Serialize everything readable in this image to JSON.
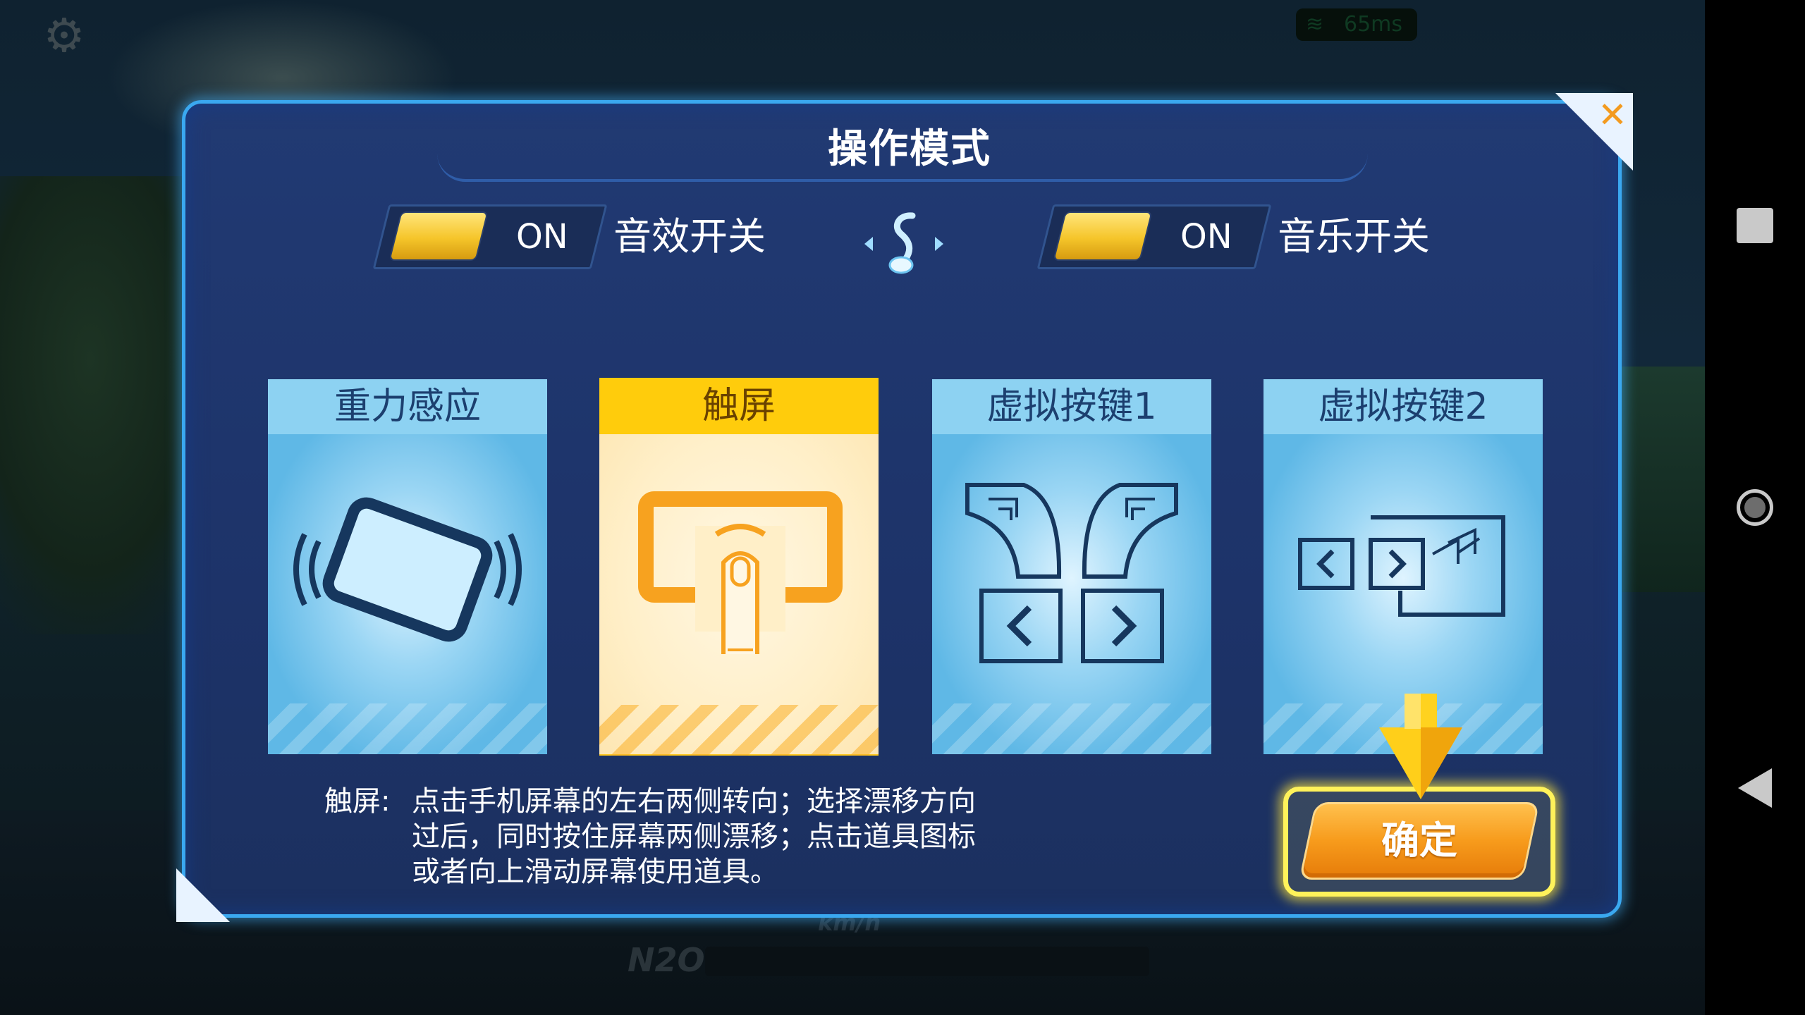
{
  "hud": {
    "ping": "65ms",
    "speed_unit": "km/h",
    "nitro_label": "N2O"
  },
  "dialog": {
    "title": "操作模式",
    "close_glyph": "✕",
    "sound_toggle": {
      "state": "ON",
      "label": "音效开关"
    },
    "music_toggle": {
      "state": "ON",
      "label": "音乐开关"
    },
    "modes": [
      {
        "label": "重力感应",
        "icon": "tilt-phone-icon",
        "selected": false
      },
      {
        "label": "触屏",
        "icon": "touch-screen-icon",
        "selected": true
      },
      {
        "label": "虚拟按键1",
        "icon": "virtual-keys-1-icon",
        "selected": false
      },
      {
        "label": "虚拟按键2",
        "icon": "virtual-keys-2-icon",
        "selected": false
      }
    ],
    "description": {
      "prefix": "触屏:",
      "line1": "点击手机屏幕的左右两侧转向；选择漂移方向",
      "line2": "过后，同时按住屏幕两侧漂移；点击道具图标",
      "line3": "或者向上滑动屏幕使用道具。"
    },
    "confirm_label": "确定"
  },
  "colors": {
    "panel": "#213a73",
    "border_glow": "#3aa8f0",
    "card_blue": "#5fb8e6",
    "card_selected_header": "#ffcc0c",
    "toggle_knob": "#f5c52a",
    "confirm_orange": "#f79b1c",
    "confirm_highlight": "#fff25a",
    "close_x": "#f39a1f"
  }
}
